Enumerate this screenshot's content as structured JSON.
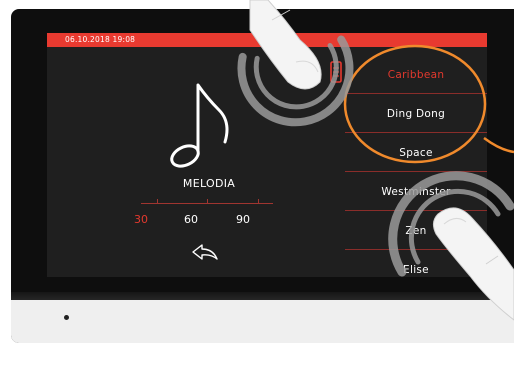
{
  "status_bar": {
    "datetime": "06.10.2018  19:08"
  },
  "melody": {
    "title": "MELODIA",
    "volume_levels": [
      "30",
      "60",
      "90"
    ],
    "selected_volume": "30"
  },
  "melody_list": {
    "items": [
      {
        "label": "Caribbean",
        "selected": true
      },
      {
        "label": "Ding Dong",
        "selected": false
      },
      {
        "label": "Space",
        "selected": false
      },
      {
        "label": "Westminster",
        "selected": false
      },
      {
        "label": "Zen",
        "selected": false
      },
      {
        "label": "Elise",
        "selected": false
      }
    ]
  },
  "icons": {
    "note": "music-note-icon",
    "back": "back-arrow-icon",
    "document": "document-icon"
  },
  "colors": {
    "accent": "#e83a30",
    "highlight_ring": "#f08a2c",
    "screen_bg": "#1f1f1f",
    "separator": "#8a2d2a"
  }
}
